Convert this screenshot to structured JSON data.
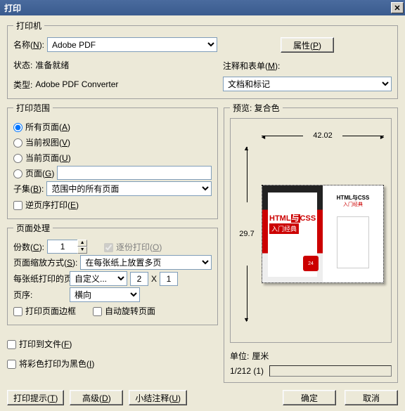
{
  "title": "打印",
  "printer": {
    "legend": "打印机",
    "name_label": "名称",
    "name_key": "N",
    "name_value": "Adobe PDF",
    "properties_btn": "属性",
    "properties_key": "P",
    "status_label": "状态:",
    "status_value": "准备就绪",
    "type_label": "类型:",
    "type_value": "Adobe PDF Converter",
    "comments_label": "注释和表单",
    "comments_key": "M",
    "comments_value": "文档和标记"
  },
  "range": {
    "legend": "打印范围",
    "all": "所有页面",
    "all_key": "A",
    "view": "当前视图",
    "view_key": "V",
    "current": "当前页面",
    "current_key": "U",
    "pages": "页面",
    "pages_key": "G",
    "pages_value": "",
    "subset_label": "子集",
    "subset_key": "B",
    "subset_value": "范围中的所有页面",
    "reverse": "逆页序打印",
    "reverse_key": "E"
  },
  "handling": {
    "legend": "页面处理",
    "copies_label": "份数",
    "copies_key": "C",
    "copies_value": "1",
    "collate": "逐份打印",
    "collate_key": "O",
    "scaling_label": "页面缩放方式",
    "scaling_key": "S",
    "scaling_value": "在每张纸上放置多页",
    "persheet_label": "每张纸打印的页数:",
    "persheet_value": "自定义...",
    "custom_x": "2",
    "custom_y": "1",
    "x_sep": "X",
    "order_label": "页序:",
    "order_value": "横向",
    "border": "打印页面边框",
    "autorotate": "自动旋转页面"
  },
  "opts": {
    "tofile": "打印到文件",
    "tofile_key": "F",
    "grayscale": "将彩色打印为黑色",
    "grayscale_key": "I"
  },
  "preview": {
    "legend": "预览: 复合色",
    "width": "42.02",
    "height": "29.7",
    "units_label": "单位:",
    "units_value": "厘米",
    "page_indicator": "1/212 (1)",
    "thumb_title1a": "HTML",
    "thumb_title1b": "CSS",
    "thumb_and": "与",
    "thumb_sub": "入门经典",
    "thumb_hours": "24",
    "thumb_title2": "HTML与CSS",
    "thumb_sub2": "入门经典"
  },
  "footer": {
    "tips": "打印提示",
    "tips_key": "T",
    "advanced": "高级",
    "advanced_key": "D",
    "summary": "小结注释",
    "summary_key": "U",
    "ok": "确定",
    "cancel": "取消"
  }
}
